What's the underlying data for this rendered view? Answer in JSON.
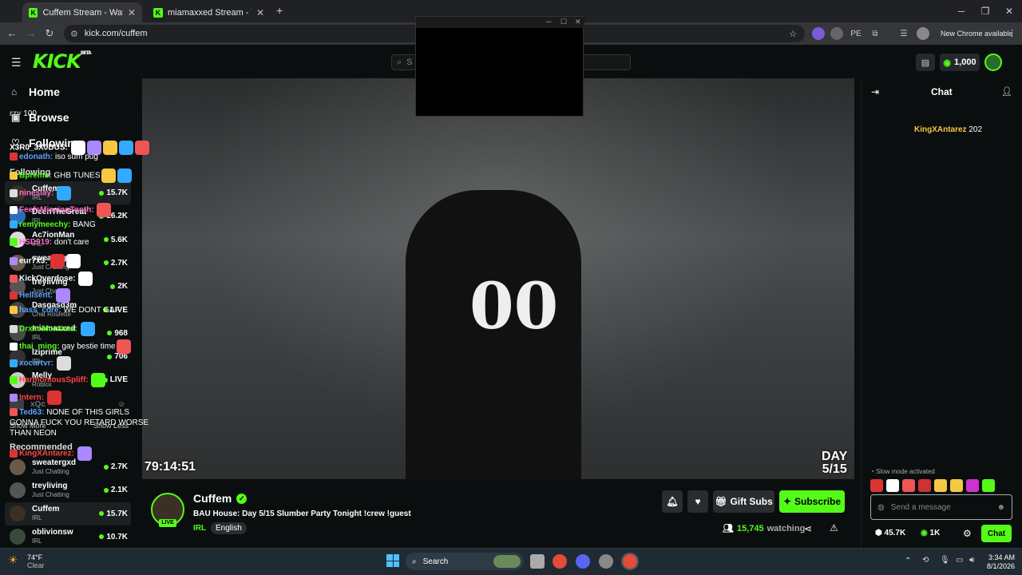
{
  "browser": {
    "tabs": [
      {
        "title": "Cuffem Stream - Watch Live",
        "active": true
      },
      {
        "title": "miamaxxed Stream - Watch Live",
        "active": false
      }
    ],
    "url": "kick.com/cuffem",
    "chrome_notice": "New Chrome available"
  },
  "header": {
    "logo": "KICK",
    "logo_tag": "BETA",
    "search_placeholder": "S",
    "points": "1,000"
  },
  "sidebar": {
    "nav": [
      {
        "label": "Home",
        "icon": "home-icon"
      },
      {
        "label": "Browse",
        "icon": "browse-icon"
      },
      {
        "label": "Following",
        "icon": "heart-icon"
      }
    ],
    "following_title": "Following",
    "following": [
      {
        "name": "Cuffem",
        "category": "IRL",
        "viewers": "15.7K",
        "color": "#3a3024"
      },
      {
        "name": "DeenTheGreat",
        "category": "IRL",
        "viewers": "16.2K",
        "color": "#2d6fb5"
      },
      {
        "name": "Ac7ionMan",
        "category": "IRL",
        "viewers": "5.6K",
        "color": "#ddd"
      },
      {
        "name": "sweatergxd",
        "category": "Just Chatting",
        "viewers": "2.7K",
        "color": "#6a5a4a"
      },
      {
        "name": "treyliving",
        "category": "Just Chatting",
        "viewers": "2K",
        "color": "#555"
      },
      {
        "name": "Dasgasd3m",
        "category": "Chat Roulette",
        "viewers": "LIVE",
        "color": "#444"
      },
      {
        "name": "miamaxxed",
        "category": "IRL",
        "viewers": "968",
        "color": "#4a4a4a"
      },
      {
        "name": "lziprime",
        "category": "IRL",
        "viewers": "706",
        "color": "#333"
      },
      {
        "name": "Melly",
        "category": "Roblox",
        "viewers": "LIVE",
        "color": "#ccc"
      }
    ],
    "offline": "xQc",
    "show_more": "Show More",
    "show_less": "Show Less",
    "recommended_title": "Recommended",
    "recommended": [
      {
        "name": "sweatergxd",
        "category": "Just Chatting",
        "viewers": "2.7K",
        "color": "#6a5a4a"
      },
      {
        "name": "treyliving",
        "category": "Just Chatting",
        "viewers": "2.1K",
        "color": "#555"
      },
      {
        "name": "Cuffem",
        "category": "IRL",
        "viewers": "15.7K",
        "color": "#3a3024"
      },
      {
        "name": "oblivionsw",
        "category": "IRL",
        "viewers": "10.7K",
        "color": "#3a4a3a"
      }
    ]
  },
  "video": {
    "timer": "79:14:51",
    "day_label": "DAY",
    "day_value": "5/15"
  },
  "stream": {
    "name": "Cuffem",
    "title": "BAU House: Day 5/15 Slumber Party Tonight !crew !guest",
    "category": "IRL",
    "language": "English",
    "live": "LIVE",
    "gift_label": "Gift Subs",
    "subscribe_label": "Subscribe",
    "watching": "15,745",
    "watching_label": "watching"
  },
  "chat": {
    "title": "Chat",
    "messages": [
      {
        "user": "rzy",
        "text": "100",
        "color": "#aaa"
      },
      {
        "user": "KingXAntarez",
        "text": "202",
        "color": "#f5c842"
      },
      {
        "user": "X3R0_3X0DUS:",
        "text": "",
        "color": "#fff"
      },
      {
        "user": "edonath:",
        "text": "iso sum pug",
        "color": "#5aa0ff"
      },
      {
        "user": "Bpreme:",
        "text": "GHB TUNES",
        "color": "#53fc18"
      },
      {
        "user": "nineslay:",
        "text": "",
        "color": "#ff6ec7"
      },
      {
        "user": "FeefsMissingTooth:",
        "text": "",
        "color": "#ff6ec7"
      },
      {
        "user": "remymeechy:",
        "text": "BANG",
        "color": "#53fc18"
      },
      {
        "user": "HSD919:",
        "text": "don't care",
        "color": "#ff6ec7"
      },
      {
        "user": "eur7x3:",
        "text": "",
        "color": "#fff"
      },
      {
        "user": "KickOverdose:",
        "text": "",
        "color": "#fff"
      },
      {
        "user": "Hellsent:",
        "text": "",
        "color": "#5aa0ff"
      },
      {
        "user": "hass_core:",
        "text": "WE DONT GAF",
        "color": "#5aa0ff"
      },
      {
        "user": "DrxkoMontana:",
        "text": "",
        "color": "#53fc18"
      },
      {
        "user": "thai_ming:",
        "text": "gay bestie time",
        "color": "#53fc18"
      },
      {
        "user": "xocartvr:",
        "text": "",
        "color": "#5aa0ff"
      },
      {
        "user": "HarmoniousSpliff:",
        "text": "",
        "color": "#ff4444"
      },
      {
        "user": "Intern:",
        "text": "",
        "color": "#ff4444"
      },
      {
        "user": "Ted63:",
        "text": "NONE OF THIS GIRLS GONNA FUCK YOU RETARD WORSE THAN NEON",
        "color": "#5aa0ff"
      },
      {
        "user": "KingXAntarez:",
        "text": "",
        "color": "#ff4444"
      }
    ],
    "slow_mode": "Slow mode activated",
    "input_placeholder": "Send a message",
    "followers": "45.7K",
    "points": "1K",
    "chat_button": "Chat"
  },
  "taskbar": {
    "temp": "74°F",
    "weather": "Clear",
    "search": "Search",
    "time": "3:34 AM",
    "date": "8/1/2026"
  },
  "colors": {
    "brand": "#53fc18",
    "background": "#0b0e0f"
  }
}
